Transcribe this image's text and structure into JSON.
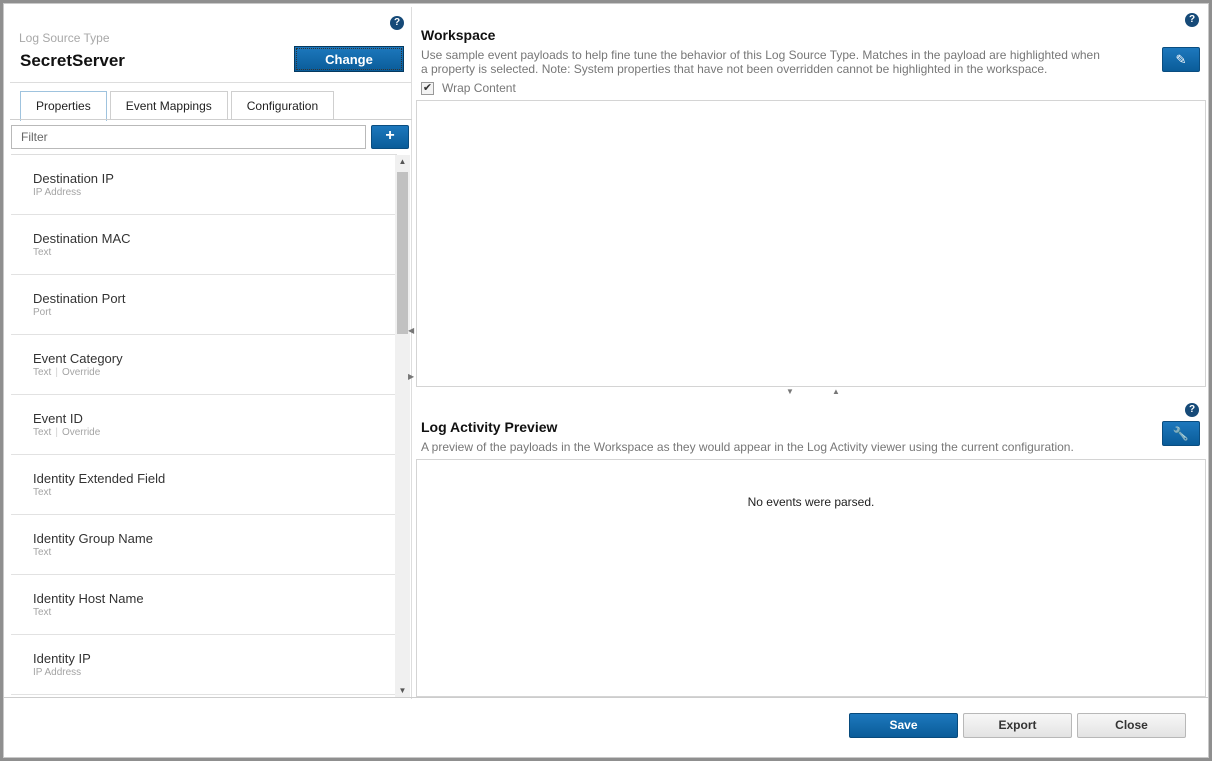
{
  "left": {
    "help_icon": "?",
    "log_source_type_label": "Log Source Type",
    "log_source_type_name": "SecretServer",
    "change_label": "Change",
    "tabs": [
      {
        "label": "Properties",
        "active": true
      },
      {
        "label": "Event Mappings",
        "active": false
      },
      {
        "label": "Configuration",
        "active": false
      }
    ],
    "filter_placeholder": "Filter",
    "add_label": "+",
    "properties": [
      {
        "name": "Destination IP",
        "type": "IP Address",
        "override": ""
      },
      {
        "name": "Destination MAC",
        "type": "Text",
        "override": ""
      },
      {
        "name": "Destination Port",
        "type": "Port",
        "override": ""
      },
      {
        "name": "Event Category",
        "type": "Text",
        "override": "Override"
      },
      {
        "name": "Event ID",
        "type": "Text",
        "override": "Override"
      },
      {
        "name": "Identity Extended Field",
        "type": "Text",
        "override": ""
      },
      {
        "name": "Identity Group Name",
        "type": "Text",
        "override": ""
      },
      {
        "name": "Identity Host Name",
        "type": "Text",
        "override": ""
      },
      {
        "name": "Identity IP",
        "type": "IP Address",
        "override": ""
      }
    ]
  },
  "workspace": {
    "help_icon": "?",
    "title": "Workspace",
    "description": "Use sample event payloads to help fine tune the behavior of this Log Source Type. Matches in the payload are highlighted when a property is selected. Note: System properties that have not been overridden cannot be highlighted in the workspace.",
    "wrap_content_label": "Wrap Content",
    "wrap_content_checked": true,
    "edit_icon": "pencil-icon"
  },
  "preview": {
    "help_icon": "?",
    "title": "Log Activity Preview",
    "description": "A preview of the payloads in the Workspace as they would appear in the Log Activity viewer using the current configuration.",
    "settings_icon": "wrench-icon",
    "empty_message": "No events were parsed."
  },
  "footer": {
    "save_label": "Save",
    "export_label": "Export",
    "close_label": "Close"
  },
  "colors": {
    "primary": "#0a5c99",
    "help_icon": "#164a78"
  }
}
